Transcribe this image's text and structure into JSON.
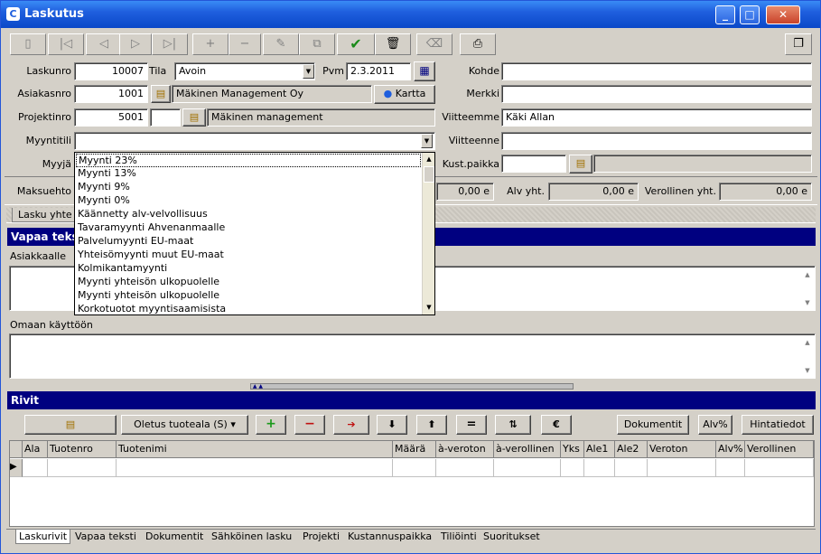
{
  "window": {
    "title": "Laskutus",
    "controls": [
      "minimize",
      "maximize",
      "close"
    ]
  },
  "toolbar": {
    "buttons": [
      "form",
      "first",
      "prev",
      "next",
      "last",
      "add",
      "remove",
      "edit",
      "copy",
      "save",
      "delete",
      "clear",
      "print",
      "window"
    ]
  },
  "header": {
    "laskunro_label": "Laskunro",
    "laskunro": "10007",
    "tila_label": "Tila",
    "tila": "Avoin",
    "pvm_label": "Pvm",
    "pvm": "2.3.2011",
    "asiakasnro_label": "Asiakasnro",
    "asiakasnro": "1001",
    "asiakas_nimi": "Mäkinen Management Oy",
    "kartta_label": "Kartta",
    "projektinro_label": "Projektinro",
    "projektinro": "5001",
    "projekti_nimi": "Mäkinen management",
    "myyntitili_label": "Myyntitili",
    "myyntitili": "",
    "myyja_label": "Myyjä",
    "maksuehto_label": "Maksuehto",
    "kohde_label": "Kohde",
    "kohde": "",
    "merkki_label": "Merkki",
    "merkki": "",
    "viitteemme_label": "Viitteemme",
    "viitteemme": "Käki Allan",
    "viitteenne_label": "Viitteenne",
    "viitteenne": "",
    "kustpaikka_label": "Kust.paikka",
    "kustpaikka": "",
    "total_value": "0,00 e",
    "alv_label": "Alv yht.",
    "alv_value": "0,00 e",
    "verollinen_label": "Verollinen yht.",
    "verollinen_value": "0,00 e"
  },
  "top_tab": "Lasku yhte",
  "vapaa": {
    "title": "Vapaa teks",
    "asiakkaalle_label": "Asiakkaalle",
    "omaan_label": "Omaan käyttöön"
  },
  "dropdown": {
    "items": [
      "Myynti 23%",
      "Myynti 13%",
      "Myynti 9%",
      "Myynti 0%",
      "Käännetty alv-velvollisuus",
      "Tavaramyynti Ahvenanmaalle",
      "Palvelumyynti EU-maat",
      "Yhteisömyynti muut EU-maat",
      "Kolmikantamyynti",
      "Myynti yhteisön ulkopuolelle",
      "Myynti yhteisön ulkopuolelle",
      "Korkotuotot myyntisaamisista"
    ]
  },
  "rivit": {
    "title": "Rivit",
    "oletus_label": "Oletus tuoteala (S)",
    "dokumentit_label": "Dokumentit",
    "alv_label": "Alv%",
    "hintatiedot_label": "Hintatiedot",
    "euro_label": "€",
    "equals_label": "=",
    "columns": [
      "Ala",
      "Tuotenro",
      "Tuotenimi",
      "Määrä",
      "à-veroton",
      "à-verollinen",
      "Yks",
      "Ale1",
      "Ale2",
      "Veroton",
      "Alv%",
      "Verollinen"
    ]
  },
  "bottom_tabs": [
    "Laskurivit",
    "Vapaa teksti",
    "Dokumentit",
    "Sähköinen lasku",
    "Projekti",
    "Kustannuspaikka",
    "Tiliöinti",
    "Suoritukset"
  ],
  "colors": {
    "titlebar": "#1f5fde",
    "section_bar": "#000080",
    "face": "#d4d0c8",
    "check": "#1a8a1a",
    "add_green": "#1a9a1a",
    "remove_red": "#c01010"
  }
}
